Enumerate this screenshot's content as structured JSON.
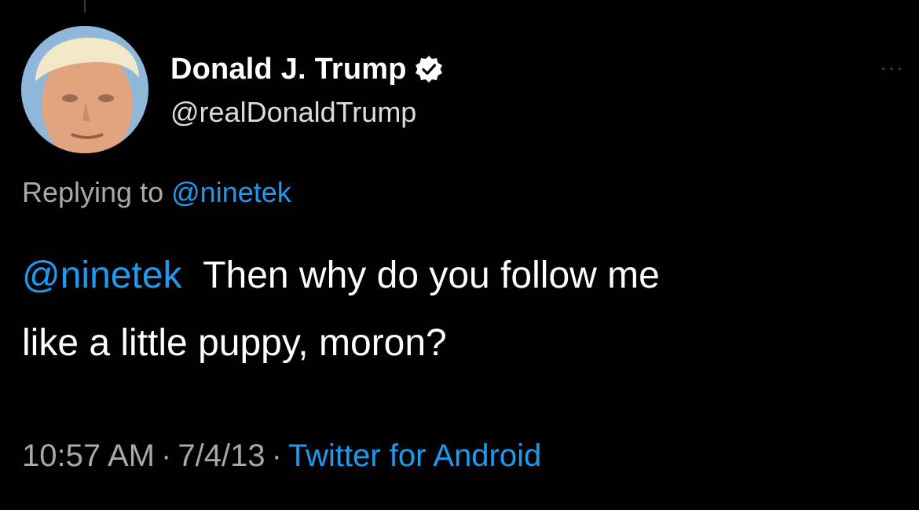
{
  "tweet": {
    "author": {
      "display_name": "Donald J. Trump",
      "handle": "@realDonaldTrump",
      "verified": true,
      "avatar_icon": "profile-photo"
    },
    "more_icon": "ellipsis-icon",
    "reply": {
      "prefix": "Replying to",
      "mention": "@ninetek"
    },
    "body": {
      "mention": "@ninetek",
      "line1": "Then why do you follow me",
      "line2": "like a little puppy, moron?"
    },
    "meta": {
      "time": "10:57 AM",
      "date": "7/4/13",
      "separator": "·",
      "source": "Twitter for Android"
    }
  },
  "colors": {
    "background": "#000000",
    "text": "#ffffff",
    "secondary": "#a8a8a8",
    "accent": "#1d9bf0"
  }
}
